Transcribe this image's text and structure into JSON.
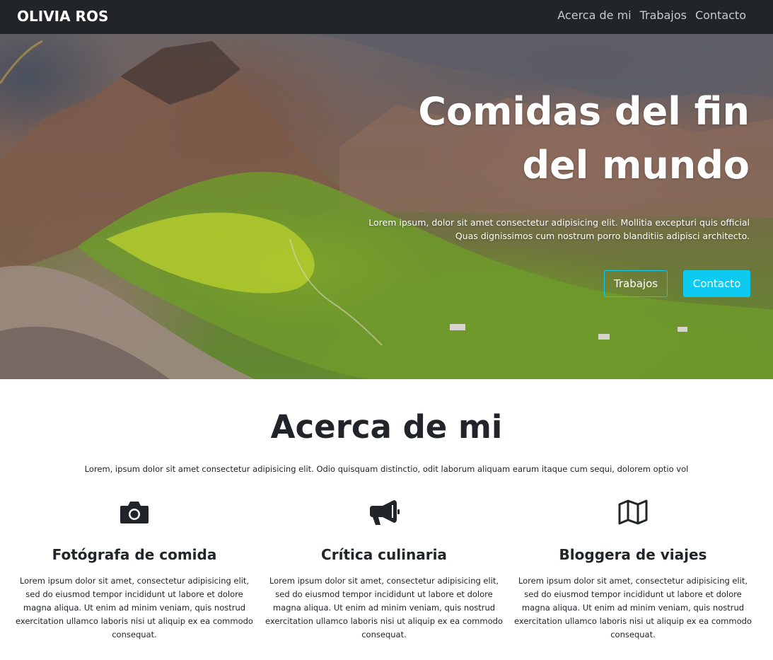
{
  "nav": {
    "brand": "OLIVIA ROS",
    "links": [
      "Acerca de mi",
      "Trabajos",
      "Contacto"
    ]
  },
  "hero": {
    "title": "Comidas del fin del mundo",
    "text": "Lorem ipsum, dolor sit amet consectetur adipisicing elit. Mollitia excepturi quis official Quas dignissimos cum nostrum porro blanditiis adipisci architecto.",
    "buttons": [
      "Trabajos",
      "Contacto"
    ]
  },
  "about": {
    "title": "Acerca de mi",
    "text": "Lorem, ipsum dolor sit amet consectetur adipisicing elit. Odio quisquam distinctio, odit laborum aliquam earum itaque cum sequi, dolorem optio vol",
    "features": [
      {
        "icon": "camera-icon",
        "title": "Fotógrafa de comida",
        "text": "Lorem ipsum dolor sit amet, consectetur adipisicing elit, sed do eiusmod tempor incididunt ut labore et dolore magna aliqua. Ut enim ad minim veniam, quis nostrud exercitation ullamco laboris nisi ut aliquip ex ea commodo consequat."
      },
      {
        "icon": "megaphone-icon",
        "title": "Crítica culinaria",
        "text": "Lorem ipsum dolor sit amet, consectetur adipisicing elit, sed do eiusmod tempor incididunt ut labore et dolore magna aliqua. Ut enim ad minim veniam, quis nostrud exercitation ullamco laboris nisi ut aliquip ex ea commodo consequat."
      },
      {
        "icon": "map-icon",
        "title": "Bloggera de viajes",
        "text": "Lorem ipsum dolor sit amet, consectetur adipisicing elit, sed do eiusmod tempor incididunt ut labore et dolore magna aliqua. Ut enim ad minim veniam, quis nostrud exercitation ullamco laboris nisi ut aliquip ex ea commodo consequat."
      }
    ]
  },
  "colors": {
    "navbar": "#212529",
    "accent": "#0dcaf0",
    "text": "#212529"
  }
}
